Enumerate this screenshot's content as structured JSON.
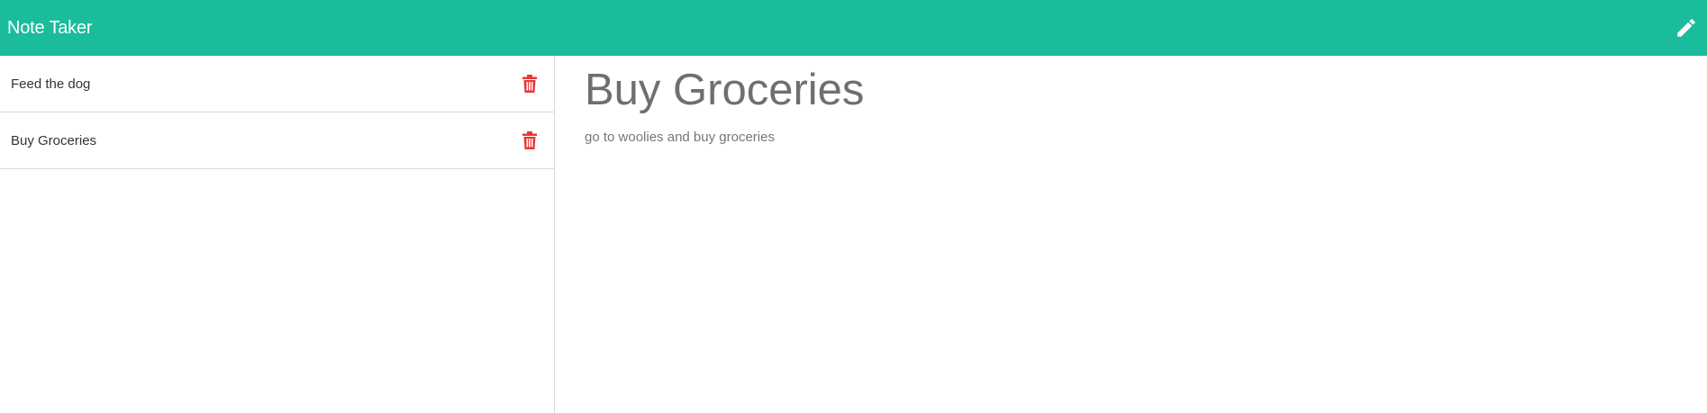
{
  "app": {
    "title": "Note Taker",
    "accent_color": "#1abc9c",
    "delete_color": "#e53935",
    "new_note_icon": "pencil-icon",
    "delete_icon": "trash-icon"
  },
  "notes": [
    {
      "title": "Feed the dog"
    },
    {
      "title": "Buy Groceries"
    }
  ],
  "active_note": {
    "title": "Buy Groceries",
    "text": "go to woolies and buy groceries"
  }
}
